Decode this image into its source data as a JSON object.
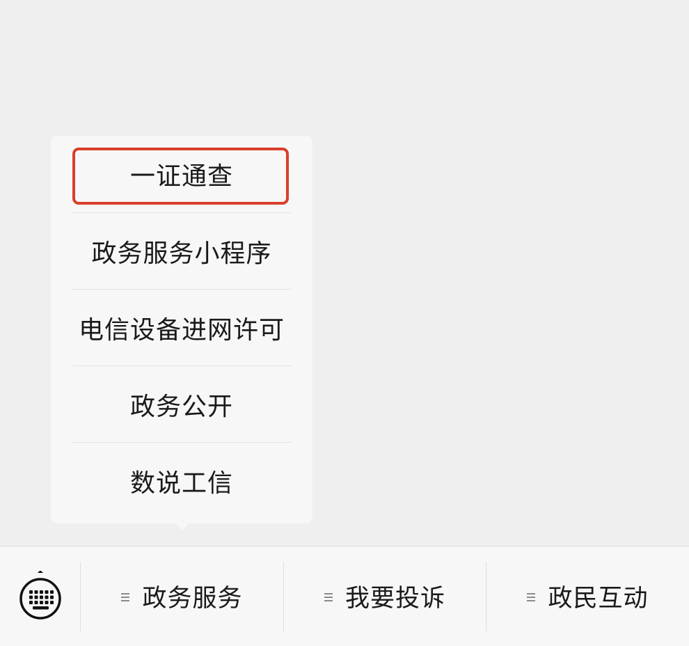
{
  "submenu": {
    "items": [
      {
        "label": "一证通查",
        "highlighted": true
      },
      {
        "label": "政务服务小程序"
      },
      {
        "label": "电信设备进网许可"
      },
      {
        "label": "政务公开"
      },
      {
        "label": "数说工信"
      }
    ],
    "highlight_color": "#d9402b"
  },
  "bottom_menu": {
    "keyboard_icon": "keyboard-icon",
    "tabs": [
      {
        "label": "政务服务",
        "icon": "menu-lines-icon"
      },
      {
        "label": "我要投诉",
        "icon": "menu-lines-icon"
      },
      {
        "label": "政民互动",
        "icon": "menu-lines-icon"
      }
    ]
  }
}
